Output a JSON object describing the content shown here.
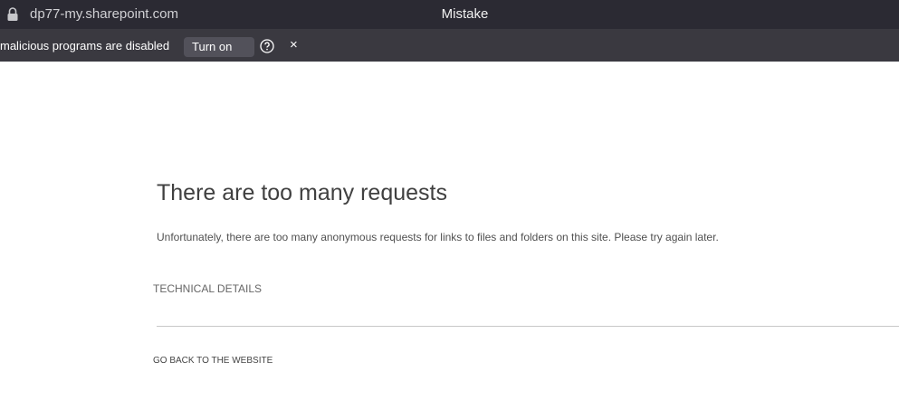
{
  "titlebar": {
    "url": "dp77-my.sharepoint.com",
    "title": "Mistake",
    "lock_icon": "lock-icon"
  },
  "infobar": {
    "message": "malicious programs are disabled",
    "button_label": "Turn on",
    "help_icon": "question-circle-icon",
    "close_label": "×"
  },
  "page": {
    "heading": "There are too many requests",
    "message": "Unfortunately, there are too many anonymous requests for links to files and folders on this site. Please try again later.",
    "tech_details_label": "TECHNICAL DETAILS",
    "back_link_label": "GO BACK TO THE WEBSITE"
  },
  "colors": {
    "titlebar_bg": "#2b2a33",
    "infobar_bg": "#3a3940",
    "button_bg": "#52515a",
    "page_bg": "#ffffff",
    "heading_text": "#404040",
    "divider": "#c8c8c8"
  }
}
